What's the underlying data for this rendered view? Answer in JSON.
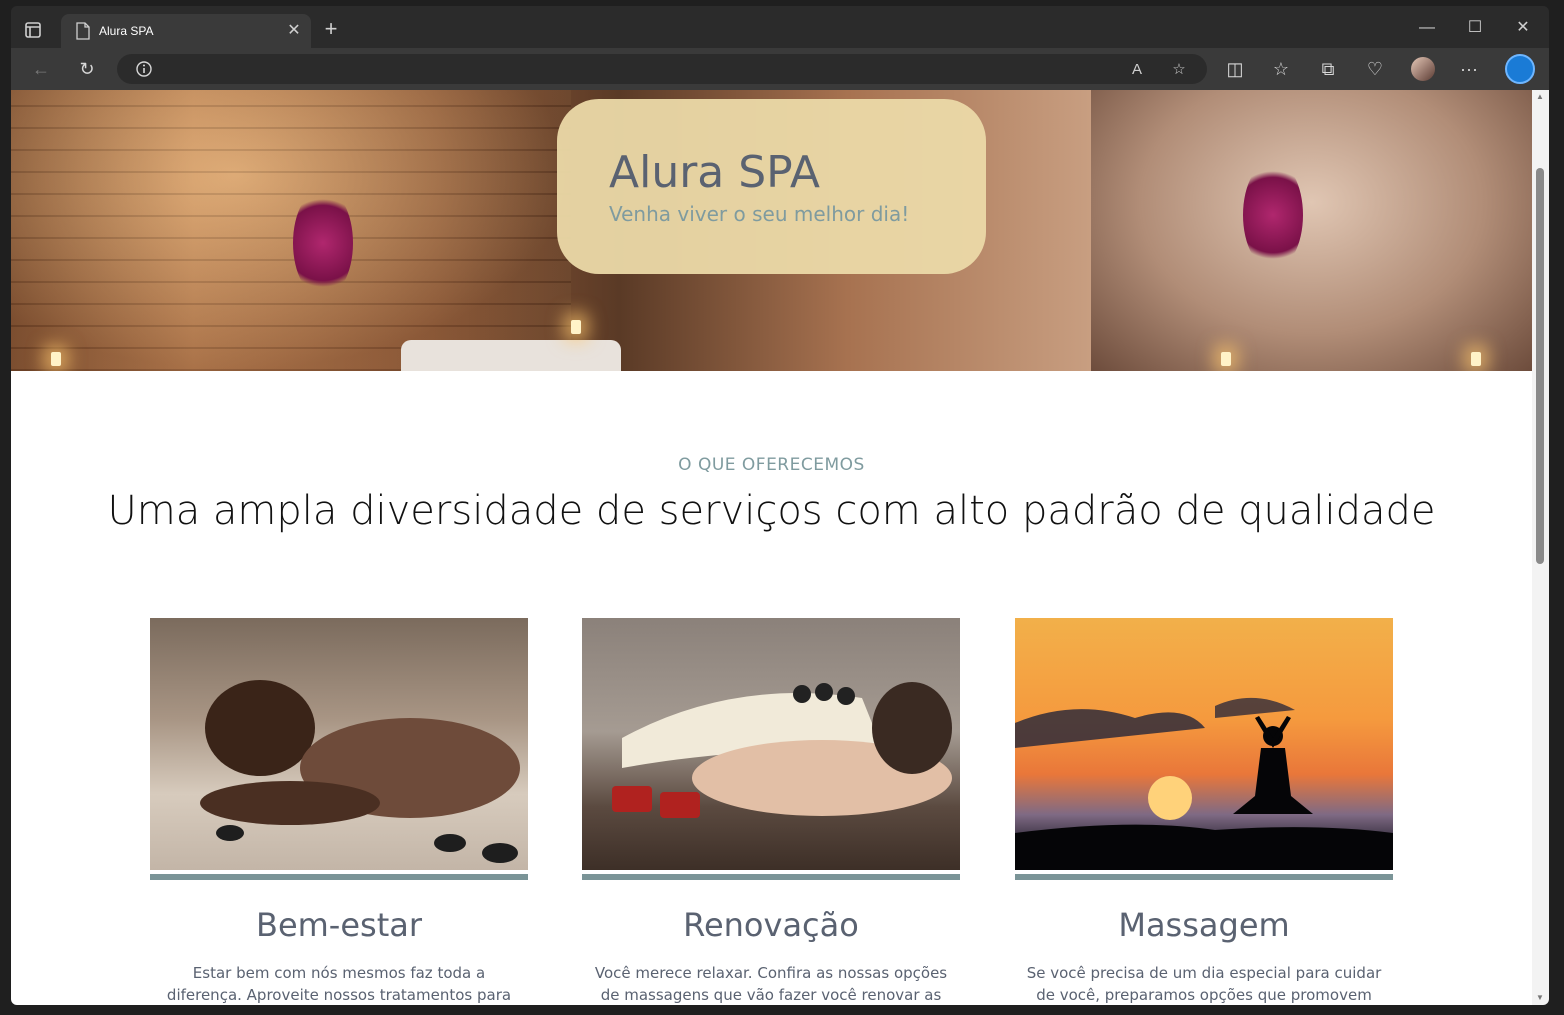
{
  "browser": {
    "tab_title": "Alura SPA",
    "tab_close": "✕",
    "new_tab": "+",
    "address_value": ""
  },
  "icons": {
    "back": "←",
    "refresh": "↻",
    "read_aloud": "A",
    "favorite": "☆",
    "split": "◫",
    "favorites": "☆",
    "collections": "⧉",
    "health": "♡",
    "more": "···",
    "minimize": "—",
    "maximize": "☐",
    "close": "✕"
  },
  "hero": {
    "title": "Alura SPA",
    "subtitle": "Venha viver o seu melhor dia!"
  },
  "section": {
    "eyebrow": "O QUE OFERECEMOS",
    "headline": "Uma ampla diversidade de serviços com alto padrão de qualidade"
  },
  "cards": [
    {
      "name": "Bem-estar",
      "desc": "Estar bem com nós mesmos faz toda a diferença. Aproveite nossos tratamentos para ter um"
    },
    {
      "name": "Renovação",
      "desc": "Você merece relaxar. Confira as nossas opções de massagens que vão fazer você renovar as energias"
    },
    {
      "name": "Massagem",
      "desc": "Se você precisa de um dia especial para cuidar de você, preparamos opções que promovem uma"
    }
  ],
  "colors": {
    "accent": "#7a9497",
    "hero_card": "#ebd9a8",
    "title_text": "#5a6271"
  }
}
